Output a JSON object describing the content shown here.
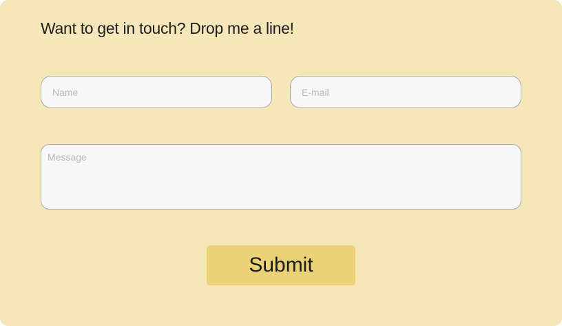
{
  "contact_form": {
    "heading": "Want to get in touch? Drop me a line!",
    "name_field": {
      "value": "",
      "placeholder": "Name"
    },
    "email_field": {
      "value": "",
      "placeholder": "E-mail"
    },
    "message_field": {
      "value": "",
      "placeholder": "Message"
    },
    "submit_label": "Submit"
  },
  "colors": {
    "card_background": "#f5e7b9",
    "field_background": "#f7f7f7",
    "field_border": "#a9a9a6",
    "button_background": "#ebd277",
    "text": "#1e1e1e",
    "placeholder": "#b9b9b9"
  }
}
